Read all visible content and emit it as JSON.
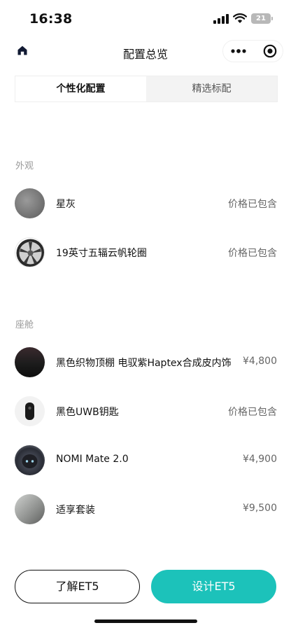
{
  "status_bar": {
    "time": "16:38",
    "battery": "21",
    "icons": [
      "signal-icon",
      "wifi-icon",
      "battery-icon"
    ]
  },
  "nav": {
    "title": "配置总览",
    "icons": [
      "home-icon",
      "more-icon",
      "target-icon"
    ]
  },
  "tabs": [
    {
      "label": "个性化配置",
      "active": true
    },
    {
      "label": "精选标配",
      "active": false
    }
  ],
  "sections": {
    "exterior": {
      "title": "外观",
      "items": [
        {
          "name": "星灰",
          "price": "价格已包含"
        },
        {
          "name": "19英寸五辐云帆轮圈",
          "price": "价格已包含"
        }
      ]
    },
    "cabin": {
      "title": "座舱",
      "items": [
        {
          "name": "黑色织物顶棚 电驭紫Haptex合成皮内饰",
          "price": "¥4,800"
        },
        {
          "name": "黑色UWB钥匙",
          "price": "价格已包含"
        },
        {
          "name": "NOMI Mate 2.0",
          "price": "¥4,900"
        },
        {
          "name": "适享套装",
          "price": "¥9,500"
        }
      ]
    }
  },
  "buttons": {
    "learn": "了解ET5",
    "design": "设计ET5"
  },
  "colors": {
    "accent": "#1cc2ba",
    "section_title": "#9a9a9a"
  }
}
